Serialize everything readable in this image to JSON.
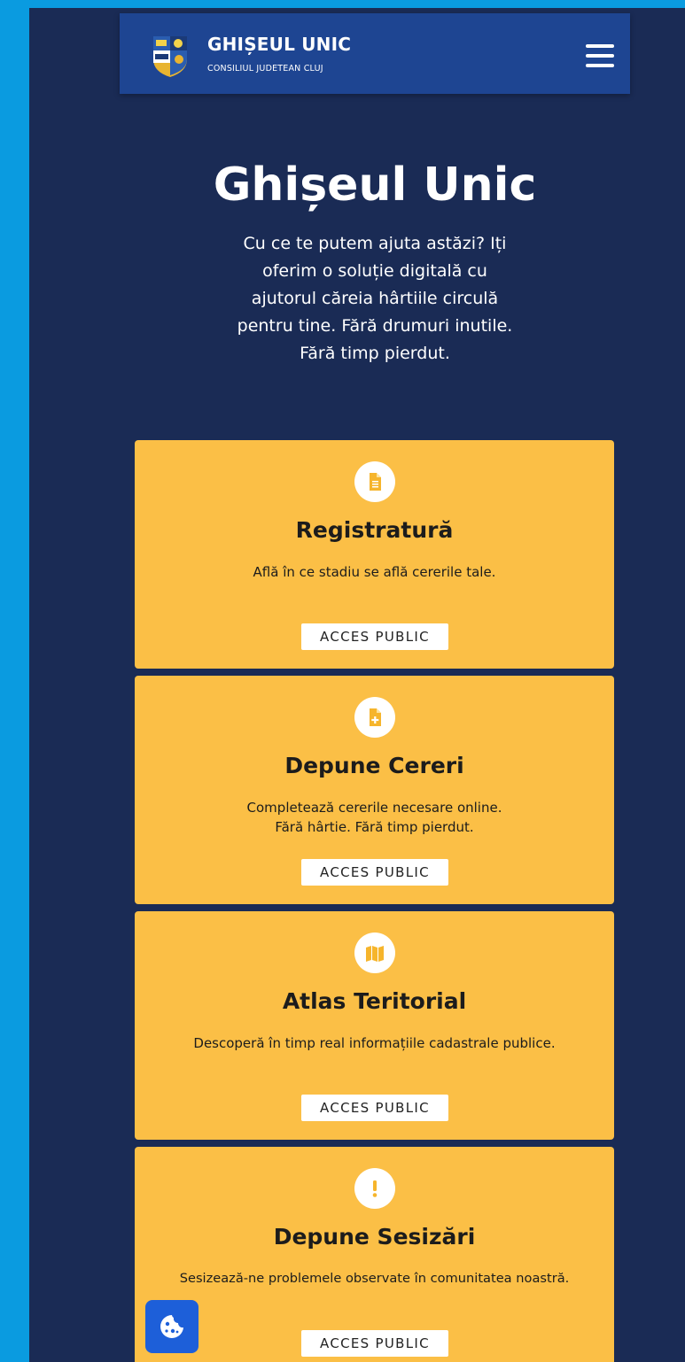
{
  "header": {
    "title": "GHIȘEUL UNIC",
    "subtitle": "CONSILIUL JUDETEAN CLUJ",
    "menu_icon": "hamburger-menu-icon"
  },
  "hero": {
    "title": "Ghișeul Unic",
    "text": "Cu ce te putem ajuta astăzi? Iți oferim o soluție digitală cu ajutorul căreia hârtiile circulă pentru tine. Fără drumuri inutile. Fără timp pierdut."
  },
  "cards": [
    {
      "icon": "document-icon",
      "title": "Registratură",
      "description": "Află în ce stadiu se află cererile tale.",
      "button": "ACCES PUBLIC"
    },
    {
      "icon": "add-document-icon",
      "title": "Depune Cereri",
      "description": "Completează cererile necesare online.\nFără hârtie. Fără timp pierdut.",
      "button": "ACCES PUBLIC"
    },
    {
      "icon": "map-icon",
      "title": "Atlas Teritorial",
      "description": "Descoperă în timp real informațiile cadastrale publice.",
      "button": "ACCES PUBLIC"
    },
    {
      "icon": "exclamation-icon",
      "title": "Depune Sesizări",
      "description": "Sesizează-ne problemele observate în comunitatea noastră.",
      "button": "ACCES PUBLIC"
    }
  ],
  "cookie_button": {
    "icon": "cookie-icon"
  },
  "colors": {
    "outer_background": "#0a9be0",
    "page_background": "#1a2b55",
    "navbar": "#1e4592",
    "card": "#fbbf46",
    "cookie_button": "#1d5fd9"
  }
}
